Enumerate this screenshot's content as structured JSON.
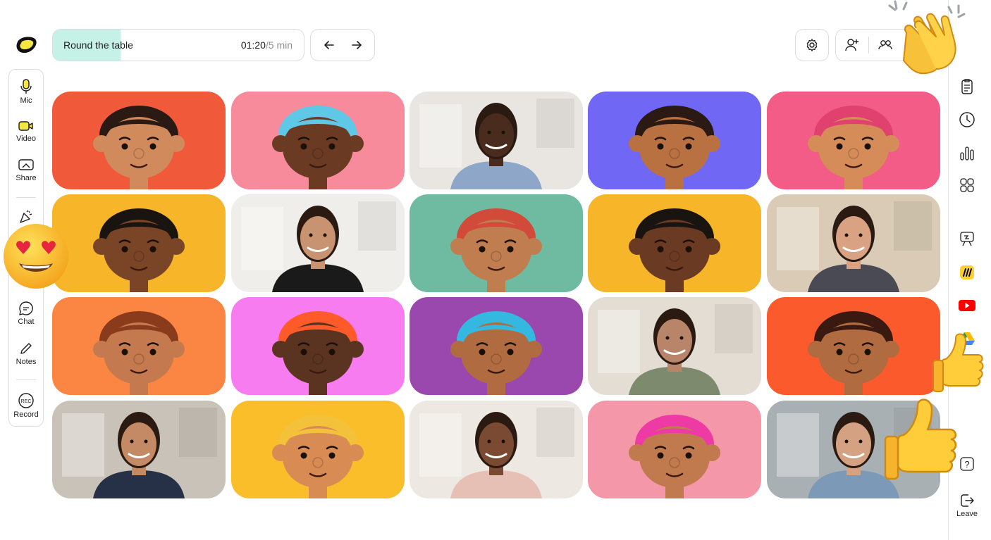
{
  "agenda": {
    "title": "Round the table",
    "elapsed": "01:20",
    "total": "/5 min",
    "progress": 0.27
  },
  "toolbar_left": {
    "mic": "Mic",
    "video": "Video",
    "share": "Share",
    "chat": "Chat",
    "notes": "Notes",
    "record": "Record",
    "record_badge": "REC"
  },
  "leave_label": "Leave",
  "colors": {
    "accent_mint": "#c6f1e7",
    "logo_yellow": "#f5e642",
    "border": "#dcdde2"
  },
  "tiles": [
    {
      "kind": "avatar",
      "bg": "#f05a3a",
      "skin": "#d08a5c",
      "hair": "#2b1a14"
    },
    {
      "kind": "avatar",
      "bg": "#f78b9c",
      "skin": "#6b3a22",
      "hair": "#5ec8e6"
    },
    {
      "kind": "photo",
      "bg": "#e9e6e1",
      "skin": "#4a2c1e",
      "shirt": "#8ea7c8"
    },
    {
      "kind": "avatar",
      "bg": "#7068f5",
      "skin": "#b97142",
      "hair": "#2b1a14"
    },
    {
      "kind": "avatar",
      "bg": "#f25c86",
      "skin": "#d68c58",
      "hair": "#e0416e"
    },
    {
      "kind": "avatar",
      "bg": "#f7b529",
      "skin": "#7a4427",
      "hair": "#1a1410"
    },
    {
      "kind": "photo",
      "bg": "#f0eeea",
      "skin": "#c89370",
      "shirt": "#1a1a1a"
    },
    {
      "kind": "avatar",
      "bg": "#6ebba1",
      "skin": "#c07d50",
      "hair": "#d24a3a"
    },
    {
      "kind": "avatar",
      "bg": "#f7b529",
      "skin": "#6b3a22",
      "hair": "#1a1410"
    },
    {
      "kind": "photo",
      "bg": "#d9cbb5",
      "skin": "#d8a283",
      "shirt": "#4a4a55"
    },
    {
      "kind": "avatar",
      "bg": "#fb8542",
      "skin": "#c47a4e",
      "hair": "#8a3b1c"
    },
    {
      "kind": "avatar",
      "bg": "#f77cf0",
      "skin": "#5a3420",
      "hair": "#ff5a2a"
    },
    {
      "kind": "avatar",
      "bg": "#9a48ad",
      "skin": "#b06b40",
      "hair": "#34b8e0"
    },
    {
      "kind": "photo",
      "bg": "#e4ddd4",
      "skin": "#b9856a",
      "shirt": "#7e8a6e"
    },
    {
      "kind": "avatar",
      "bg": "#fb5a2c",
      "skin": "#b06b40",
      "hair": "#3a1a10"
    },
    {
      "kind": "photo",
      "bg": "#c9c2b8",
      "skin": "#c48a66",
      "shirt": "#263046"
    },
    {
      "kind": "avatar",
      "bg": "#f9be2a",
      "skin": "#d88b52",
      "hair": "#f3c23a"
    },
    {
      "kind": "photo",
      "bg": "#ede8e2",
      "skin": "#7a4a32",
      "shirt": "#e6bfb5"
    },
    {
      "kind": "avatar",
      "bg": "#f497a8",
      "skin": "#c07a4e",
      "hair": "#ee3aa5"
    },
    {
      "kind": "photo",
      "bg": "#a9b0b3",
      "skin": "#d4a283",
      "shirt": "#7d99b8"
    }
  ],
  "reactions": {
    "heart_eyes": "heart-eyes-emoji",
    "clap": "clapping-hands-emoji",
    "thumbs_up": "thumbs-up-emoji"
  }
}
